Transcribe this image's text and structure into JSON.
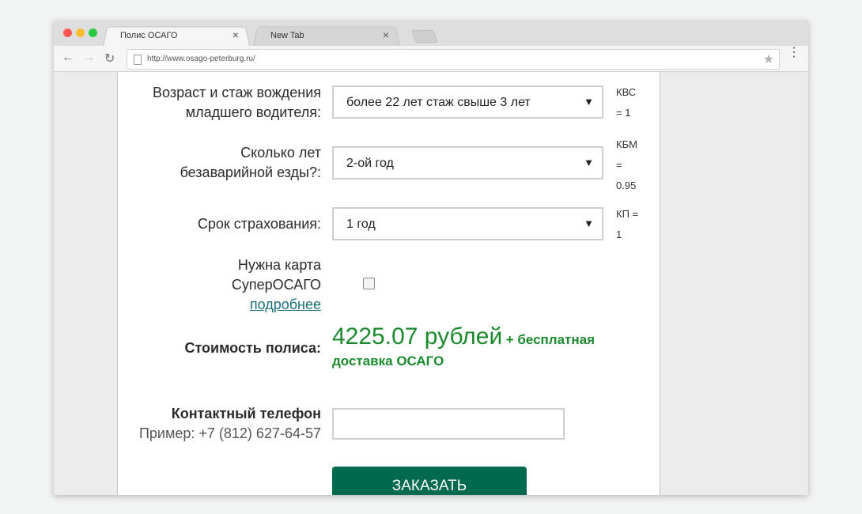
{
  "browser": {
    "tabs": [
      {
        "label": "Полис ОСАГО",
        "close": "×"
      },
      {
        "label": "New Tab",
        "close": "×"
      }
    ],
    "url": "http://www.osago-peterburg.ru/",
    "back_icon": "←",
    "forward_icon": "→",
    "reload_icon": "↻",
    "star_icon": "★",
    "menu_icon": "⋮"
  },
  "form": {
    "age": {
      "label_line1": "Возраст и стаж вождения",
      "label_line2": "младшего водителя:",
      "value": "более 22 лет стаж свыше 3 лет",
      "arrow": "▼",
      "coef_line1": "КВС",
      "coef_line2": "= 1"
    },
    "years": {
      "label_line1": "Сколько лет",
      "label_line2": "безаварийной езды?:",
      "value": "2-ой год",
      "arrow": "▼",
      "coef_line1": "КБМ",
      "coef_line2": "=",
      "coef_line3": "0.95"
    },
    "term": {
      "label": "Срок страхования:",
      "value": "1 год",
      "arrow": "▼",
      "coef_line1": "КП =",
      "coef_line2": "1"
    },
    "card": {
      "label_line1": "Нужна карта",
      "label_line2": "СуперОСАГО",
      "link": "подробнее",
      "checked": false
    },
    "cost": {
      "label": "Стоимость полиса:",
      "amount": "4225.07 рублей",
      "extra_line1": "+ бесплатная",
      "extra_line2": "доставка ОСАГО"
    },
    "phone": {
      "label": "Контактный телефон",
      "example": "Пример: +7 (812) 627-64-57",
      "value": ""
    },
    "submit_label": "ЗАКАЗАТЬ"
  },
  "colors": {
    "accent": "#006a4e",
    "price": "#1a8a2c",
    "link": "#1a6f7a"
  }
}
